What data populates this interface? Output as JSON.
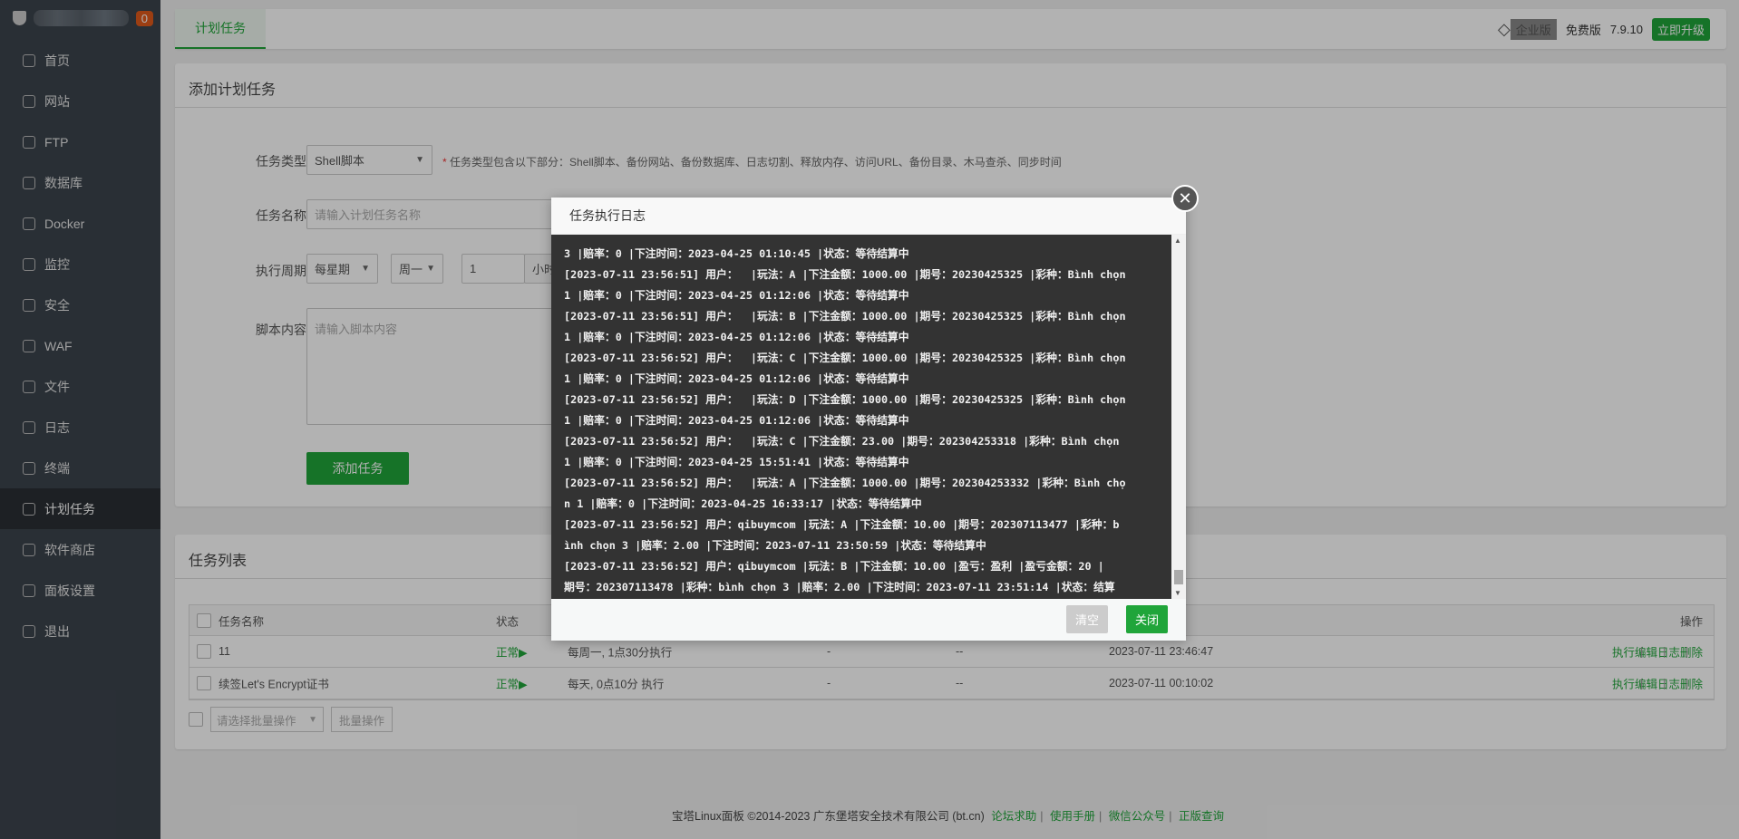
{
  "sidebar": {
    "badge": "0",
    "items": [
      {
        "label": "首页",
        "icon": "home-icon"
      },
      {
        "label": "网站",
        "icon": "globe-icon"
      },
      {
        "label": "FTP",
        "icon": "ftp-icon"
      },
      {
        "label": "数据库",
        "icon": "database-icon"
      },
      {
        "label": "Docker",
        "icon": "docker-icon"
      },
      {
        "label": "监控",
        "icon": "monitor-icon"
      },
      {
        "label": "安全",
        "icon": "shield-icon"
      },
      {
        "label": "WAF",
        "icon": "waf-icon"
      },
      {
        "label": "文件",
        "icon": "folder-icon"
      },
      {
        "label": "日志",
        "icon": "log-icon"
      },
      {
        "label": "终端",
        "icon": "terminal-icon"
      },
      {
        "label": "计划任务",
        "icon": "calendar-icon",
        "active": true
      },
      {
        "label": "软件商店",
        "icon": "store-icon"
      },
      {
        "label": "面板设置",
        "icon": "gear-icon"
      },
      {
        "label": "退出",
        "icon": "logout-icon"
      }
    ]
  },
  "header": {
    "tab": "计划任务",
    "enterprise": "企业版",
    "edition": "免费版",
    "version": "7.9.10",
    "upgrade": "立即升级"
  },
  "form": {
    "title": "添加计划任务",
    "type_label": "任务类型",
    "type_value": "Shell脚本",
    "type_hint_star": "*",
    "type_hint": "任务类型包含以下部分：Shell脚本、备份网站、备份数据库、日志切割、释放内存、访问URL、备份目录、木马查杀、同步时间",
    "name_label": "任务名称",
    "name_placeholder": "请输入计划任务名称",
    "period_label": "执行周期",
    "period_value": "每星期",
    "weekday_value": "周一",
    "hour_value": "1",
    "hour_unit": "小时",
    "script_label": "脚本内容",
    "script_placeholder": "请输入脚本内容",
    "submit": "添加任务"
  },
  "tasks": {
    "title": "任务列表",
    "columns": {
      "name": "任务名称",
      "status": "状态",
      "op": "操作"
    },
    "rows": [
      {
        "name": "11",
        "status": "正常▶",
        "cycle": "每周一, 1点30分执行",
        "a": "-",
        "b": "--",
        "time": "2023-07-11 23:46:47"
      },
      {
        "name": "续签Let's Encrypt证书",
        "status": "正常▶",
        "cycle": "每天, 0点10分 执行",
        "a": "-",
        "b": "--",
        "time": "2023-07-11 00:10:02"
      }
    ],
    "ops": [
      "执行",
      "编辑",
      "日志",
      "删除"
    ],
    "batch_placeholder": "请选择批量操作",
    "batch_button": "批量操作"
  },
  "footer": {
    "copyright": "宝塔Linux面板 ©2014-2023 广东堡塔安全技术有限公司 (bt.cn)",
    "links": [
      "论坛求助",
      "使用手册",
      "微信公众号",
      "正版查询"
    ]
  },
  "modal": {
    "title": "任务执行日志",
    "clear": "清空",
    "close": "关闭",
    "lines": [
      "3 |赔率：0 |下注时间：2023-04-25 01:10:45 |状态：等待结算中",
      "[2023-07-11 23:56:51] 用户：  |玩法：A |下注金额：1000.00 |期号：20230425325 |彩种：Bình chọn",
      "1 |赔率：0 |下注时间：2023-04-25 01:12:06 |状态：等待结算中",
      "[2023-07-11 23:56:51] 用户：  |玩法：B |下注金额：1000.00 |期号：20230425325 |彩种：Bình chọn",
      "1 |赔率：0 |下注时间：2023-04-25 01:12:06 |状态：等待结算中",
      "[2023-07-11 23:56:52] 用户：  |玩法：C |下注金额：1000.00 |期号：20230425325 |彩种：Bình chọn",
      "1 |赔率：0 |下注时间：2023-04-25 01:12:06 |状态：等待结算中",
      "[2023-07-11 23:56:52] 用户：  |玩法：D |下注金额：1000.00 |期号：20230425325 |彩种：Bình chọn",
      "1 |赔率：0 |下注时间：2023-04-25 01:12:06 |状态：等待结算中",
      "[2023-07-11 23:56:52] 用户：  |玩法：C |下注金额：23.00 |期号：202304253318 |彩种：Bình chọn",
      "1 |赔率：0 |下注时间：2023-04-25 15:51:41 |状态：等待结算中",
      "[2023-07-11 23:56:52] 用户：  |玩法：A |下注金额：1000.00 |期号：202304253332 |彩种：Bình chọ",
      "n 1 |赔率：0 |下注时间：2023-04-25 16:33:17 |状态：等待结算中",
      "[2023-07-11 23:56:52] 用户：qibuymcom |玩法：A |下注金额：10.00 |期号：202307113477 |彩种：b",
      "ình chọn 3 |赔率：2.00 |下注时间：2023-07-11 23:50:59 |状态：等待结算中",
      "[2023-07-11 23:56:52] 用户：qibuymcom |玩法：B |下注金额：10.00 |盈亏：盈利 |盈亏金额：20 |",
      "期号：202307113478 |彩种：bình chọn 3 |赔率：2.00 |下注时间：2023-07-11 23:51:14 |状态：结算"
    ]
  }
}
